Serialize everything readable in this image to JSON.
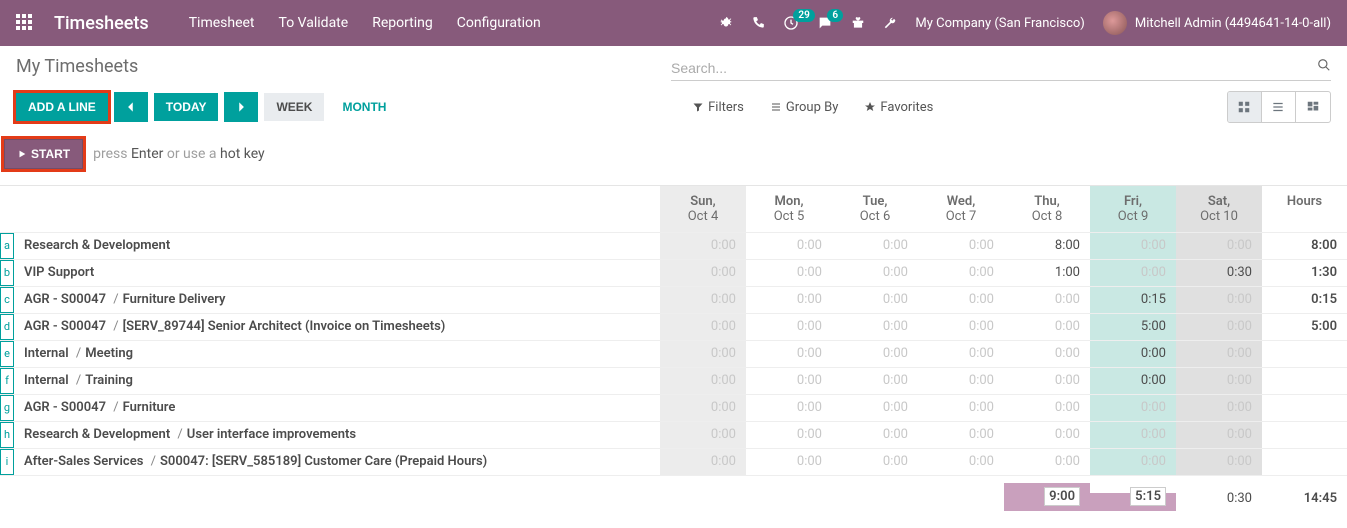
{
  "nav": {
    "brand": "Timesheets",
    "menu": [
      "Timesheet",
      "To Validate",
      "Reporting",
      "Configuration"
    ],
    "badges": {
      "clock": "29",
      "chat": "6"
    },
    "company": "My Company (San Francisco)",
    "user": "Mitchell Admin (4494641-14-0-all)"
  },
  "cp": {
    "title": "My Timesheets",
    "search_placeholder": "Search...",
    "add_line": "ADD A LINE",
    "today": "TODAY",
    "week": "WEEK",
    "month": "MONTH",
    "filters": "Filters",
    "group_by": "Group By",
    "favorites": "Favorites"
  },
  "start": {
    "label": "START",
    "hint_pre": "press ",
    "hint_key": "Enter ",
    "hint_mid": "or use a ",
    "hint_hot": "hot key"
  },
  "grid": {
    "days": [
      {
        "d1": "Sun,",
        "d2": "Oct 4",
        "cls": "sun"
      },
      {
        "d1": "Mon,",
        "d2": "Oct 5",
        "cls": ""
      },
      {
        "d1": "Tue,",
        "d2": "Oct 6",
        "cls": ""
      },
      {
        "d1": "Wed,",
        "d2": "Oct 7",
        "cls": ""
      },
      {
        "d1": "Thu,",
        "d2": "Oct 8",
        "cls": ""
      },
      {
        "d1": "Fri,",
        "d2": "Oct 9",
        "cls": "fri"
      },
      {
        "d1": "Sat,",
        "d2": "Oct 10",
        "cls": "sat"
      }
    ],
    "hours_label": "Hours",
    "rows": [
      {
        "key": "a",
        "label_parts": [
          "Research & Development"
        ],
        "cells": [
          "0:00",
          "0:00",
          "0:00",
          "0:00",
          "8:00",
          "0:00",
          "0:00"
        ],
        "has": [
          0,
          0,
          0,
          0,
          1,
          0,
          0
        ],
        "total": "8:00"
      },
      {
        "key": "b",
        "label_parts": [
          "VIP Support"
        ],
        "cells": [
          "0:00",
          "0:00",
          "0:00",
          "0:00",
          "1:00",
          "0:00",
          "0:30"
        ],
        "has": [
          0,
          0,
          0,
          0,
          1,
          0,
          1
        ],
        "total": "1:30"
      },
      {
        "key": "c",
        "label_parts": [
          "AGR - S00047",
          "Furniture Delivery"
        ],
        "cells": [
          "0:00",
          "0:00",
          "0:00",
          "0:00",
          "0:00",
          "0:15",
          "0:00"
        ],
        "has": [
          0,
          0,
          0,
          0,
          0,
          1,
          0
        ],
        "total": "0:15"
      },
      {
        "key": "d",
        "label_parts": [
          "AGR - S00047",
          "[SERV_89744] Senior Architect (Invoice on Timesheets)"
        ],
        "cells": [
          "0:00",
          "0:00",
          "0:00",
          "0:00",
          "0:00",
          "5:00",
          "0:00"
        ],
        "has": [
          0,
          0,
          0,
          0,
          0,
          1,
          0
        ],
        "total": "5:00"
      },
      {
        "key": "e",
        "label_parts": [
          "Internal",
          "Meeting"
        ],
        "cells": [
          "0:00",
          "0:00",
          "0:00",
          "0:00",
          "0:00",
          "0:00",
          "0:00"
        ],
        "has": [
          0,
          0,
          0,
          0,
          0,
          1,
          0
        ],
        "total": ""
      },
      {
        "key": "f",
        "label_parts": [
          "Internal",
          "Training"
        ],
        "cells": [
          "0:00",
          "0:00",
          "0:00",
          "0:00",
          "0:00",
          "0:00",
          "0:00"
        ],
        "has": [
          0,
          0,
          0,
          0,
          0,
          1,
          0
        ],
        "total": ""
      },
      {
        "key": "g",
        "label_parts": [
          "AGR - S00047",
          "Furniture"
        ],
        "cells": [
          "0:00",
          "0:00",
          "0:00",
          "0:00",
          "0:00",
          "0:00",
          "0:00"
        ],
        "has": [
          0,
          0,
          0,
          0,
          0,
          0,
          0
        ],
        "total": ""
      },
      {
        "key": "h",
        "label_parts": [
          "Research & Development",
          "User interface improvements"
        ],
        "cells": [
          "0:00",
          "0:00",
          "0:00",
          "0:00",
          "0:00",
          "0:00",
          "0:00"
        ],
        "has": [
          0,
          0,
          0,
          0,
          0,
          0,
          0
        ],
        "total": ""
      },
      {
        "key": "i",
        "label_parts": [
          "After-Sales Services",
          "S00047: [SERV_585189] Customer Care (Prepaid Hours)"
        ],
        "cells": [
          "0:00",
          "0:00",
          "0:00",
          "0:00",
          "0:00",
          "0:00",
          "0:00"
        ],
        "has": [
          0,
          0,
          0,
          0,
          0,
          0,
          0
        ],
        "total": ""
      }
    ],
    "totals": {
      "thu": "9:00",
      "fri": "5:15",
      "sat": "0:30",
      "grand": "14:45"
    }
  }
}
